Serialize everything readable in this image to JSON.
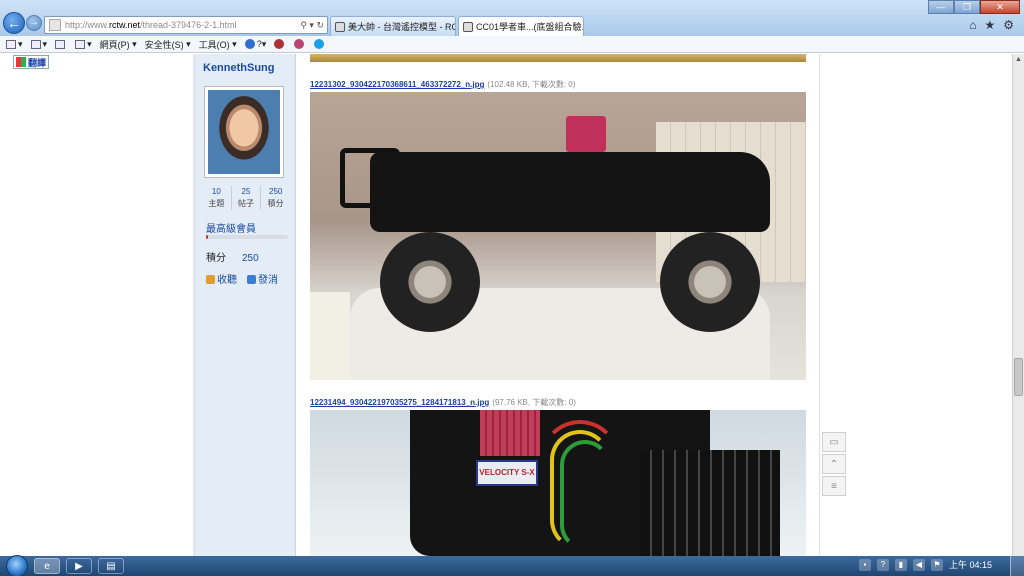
{
  "browser": {
    "address": {
      "url_prefix": "http://www.",
      "url_domain": "rctw.net",
      "url_path": "/thread-379476-2-1.html",
      "tools": "⚲ ▾ ↻"
    },
    "tabs": [
      {
        "label": "美大帥 - 台灣遙控模型 - RC T...",
        "active": false
      },
      {
        "label": "CC01學者車...(底盤組合驗...",
        "active": true
      }
    ],
    "tab_close": "✕",
    "window_buttons": {
      "minimize": "—",
      "maximize": "❐",
      "close": "✕"
    },
    "command_bar": {
      "page_menu": "網頁(P)",
      "safety_menu": "安全性(S)",
      "tools_menu": "工具(O)",
      "help_menu": "?"
    }
  },
  "page": {
    "translate_label": "翻譯",
    "user": {
      "name": "KennethSung",
      "stats": [
        {
          "value": "10",
          "label": "主題"
        },
        {
          "value": "25",
          "label": "帖子"
        },
        {
          "value": "250",
          "label": "積分"
        }
      ],
      "rank": "最高級會員",
      "rank_progress": 0.02,
      "points_label": "積分",
      "points_value": "250",
      "actions": {
        "favorite": "收聽",
        "message": "發消"
      }
    },
    "attachments": [
      {
        "filename": "12231302_930422170368611_463372272_n.jpg",
        "meta": "(102.48 KB, 下載次數: 0)"
      },
      {
        "filename": "12231494_930422197035275_1284171813_n.jpg",
        "meta": "(97.76 KB, 下載次數: 0)"
      }
    ],
    "esc_label": "VELOCITY S-X"
  },
  "taskbar": {
    "clock": "上午 04:15"
  },
  "colors": {
    "link": "#1b3ea8",
    "sidebar_bg": "#e4edf6",
    "taskbar": "#1f4672"
  }
}
